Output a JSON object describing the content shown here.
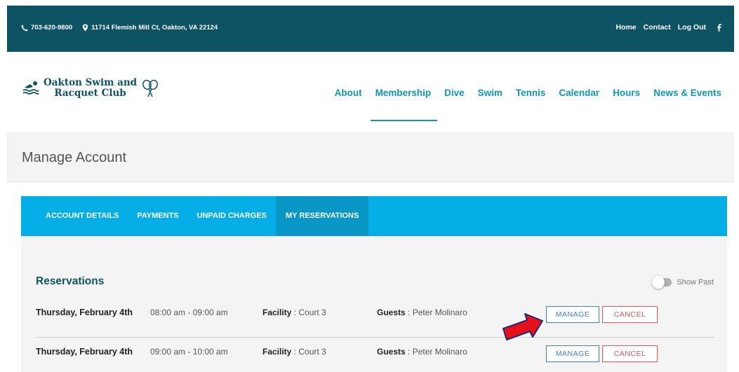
{
  "topbar": {
    "phone": "703-620-9800",
    "address": "11714 Flemish Mill Ct, Oakton, VA 22124",
    "links": [
      "Home",
      "Contact",
      "Log Out"
    ],
    "social_icon": "facebook-icon"
  },
  "header": {
    "logo_line1": "Oakton Swim and",
    "logo_line2": "Racquet Club",
    "nav": [
      "About",
      "Membership",
      "Dive",
      "Swim",
      "Tennis",
      "Calendar",
      "Hours",
      "News & Events"
    ],
    "active_nav": "Membership"
  },
  "page": {
    "title": "Manage Account"
  },
  "tabs": [
    "ACCOUNT DETAILS",
    "PAYMENTS",
    "UNPAID CHARGES",
    "MY RESERVATIONS"
  ],
  "active_tab": "MY RESERVATIONS",
  "reservations": {
    "title": "Reservations",
    "show_past_label": "Show Past",
    "facility_label": "Facility",
    "guests_label": "Guests",
    "manage_label": "MANAGE",
    "cancel_label": "CANCEL",
    "rows": [
      {
        "date": "Thursday, February 4th",
        "time": "08:00 am - 09:00 am",
        "facility": "Court 3",
        "guests": "Peter Molinaro"
      },
      {
        "date": "Thursday, February 4th",
        "time": "09:00 am - 10:00 am",
        "facility": "Court 3",
        "guests": "Peter Molinaro"
      }
    ]
  },
  "colors": {
    "topbar": "#0d5364",
    "nav": "#0d98b8",
    "tabs": "#05aee6",
    "tab_active": "#0897c7",
    "manage": "#3f7fcf",
    "cancel": "#e35454",
    "arrow": "#e8101a"
  }
}
